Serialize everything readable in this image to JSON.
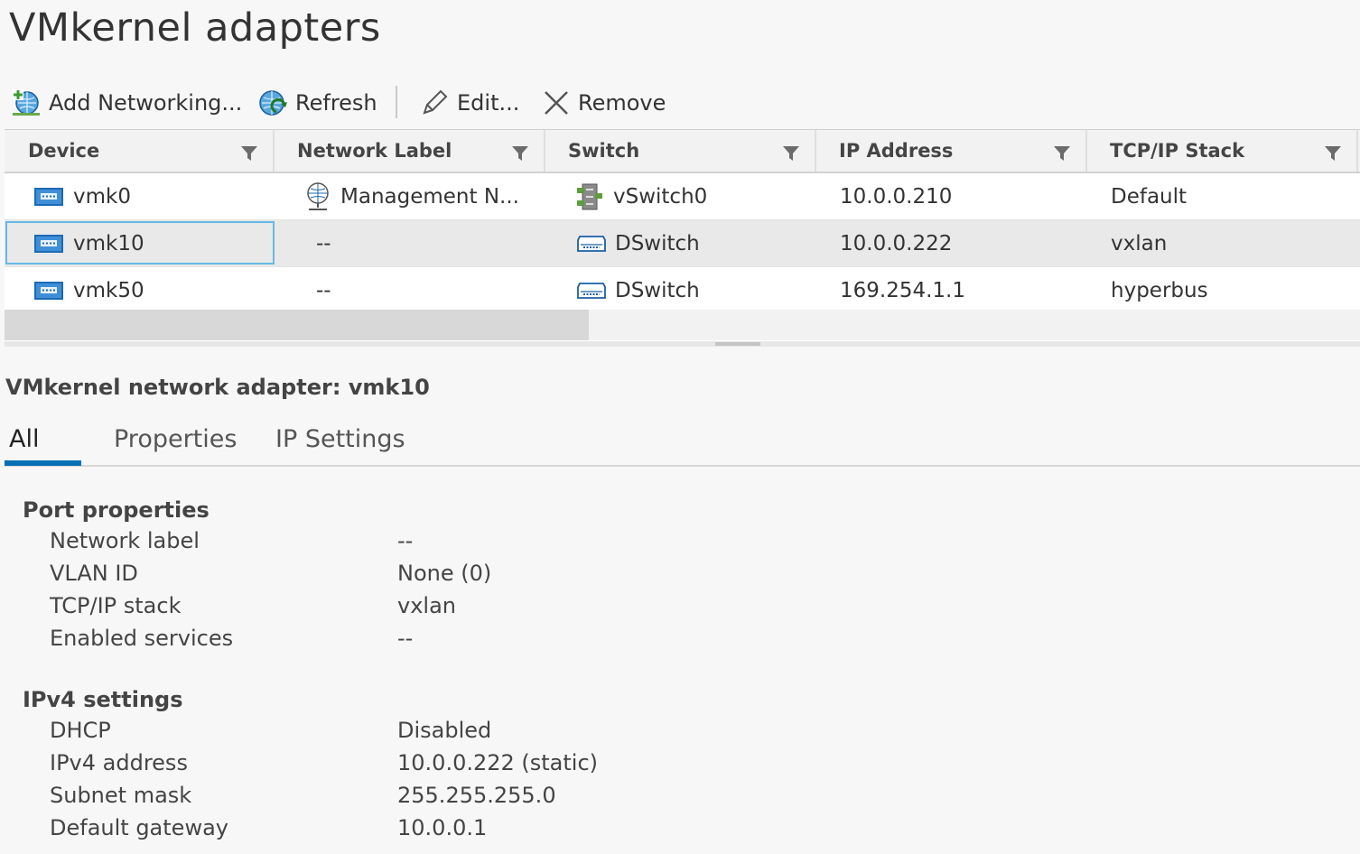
{
  "page": {
    "title": "VMkernel adapters"
  },
  "toolbar": {
    "add_networking": "Add Networking...",
    "refresh": "Refresh",
    "edit": "Edit...",
    "remove": "Remove"
  },
  "grid": {
    "columns": [
      "Device",
      "Network Label",
      "Switch",
      "IP Address",
      "TCP/IP Stack"
    ],
    "rows": [
      {
        "device": "vmk0",
        "network_label": "Management N...",
        "switch": "vSwitch0",
        "switch_icon": "standard-switch-icon",
        "ip": "10.0.0.210",
        "stack": "Default"
      },
      {
        "device": "vmk10",
        "network_label": "--",
        "switch": "DSwitch",
        "switch_icon": "distributed-switch-icon",
        "ip": "10.0.0.222",
        "stack": "vxlan"
      },
      {
        "device": "vmk50",
        "network_label": "--",
        "switch": "DSwitch",
        "switch_icon": "distributed-switch-icon",
        "ip": "169.254.1.1",
        "stack": "hyperbus"
      }
    ],
    "selected_device": "vmk10"
  },
  "details": {
    "title": "VMkernel network adapter: vmk10",
    "tabs": [
      "All",
      "Properties",
      "IP Settings"
    ],
    "active_tab": "All",
    "port_properties": {
      "heading": "Port properties",
      "items": [
        {
          "label": "Network label",
          "value": "--"
        },
        {
          "label": "VLAN ID",
          "value": "None (0)"
        },
        {
          "label": "TCP/IP stack",
          "value": "vxlan"
        },
        {
          "label": "Enabled services",
          "value": "--"
        }
      ]
    },
    "ipv4": {
      "heading": "IPv4 settings",
      "items": [
        {
          "label": "DHCP",
          "value": "Disabled"
        },
        {
          "label": "IPv4 address",
          "value": "10.0.0.222 (static)"
        },
        {
          "label": "Subnet mask",
          "value": "255.255.255.0"
        },
        {
          "label": "Default gateway",
          "value": "10.0.0.1"
        }
      ]
    }
  },
  "colors": {
    "accent": "#0a70b6",
    "selection_border": "#66b9e6",
    "icon_blue": "#1b6ab5"
  }
}
